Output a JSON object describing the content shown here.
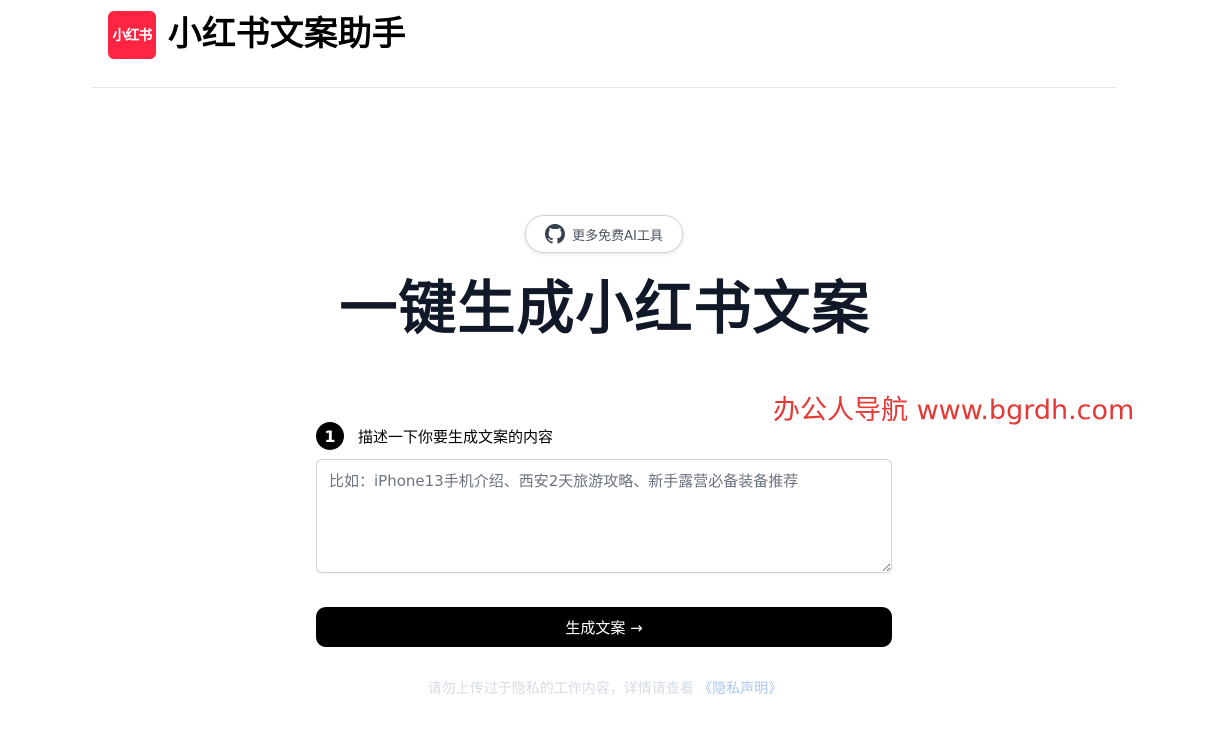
{
  "header": {
    "logo_text": "小红书",
    "app_title": "小红书文案助手",
    "brand_color": "#ff2442"
  },
  "pill": {
    "icon": "github-icon",
    "label": "更多免费AI工具"
  },
  "main": {
    "headline": "一键生成小红书文案",
    "watermark": "办公人导航 www.bgrdh.com"
  },
  "step1": {
    "number": "1",
    "label": "描述一下你要生成文案的内容",
    "input_value": "",
    "placeholder": "比如：iPhone13手机介绍、西安2天旅游攻略、新手露营必备装备推荐"
  },
  "generate_button": {
    "label": "生成文案 →"
  },
  "footer": {
    "privacy_text": "请勿上传过于隐私的工作内容，详情请查看",
    "privacy_link": "《隐私声明》"
  }
}
